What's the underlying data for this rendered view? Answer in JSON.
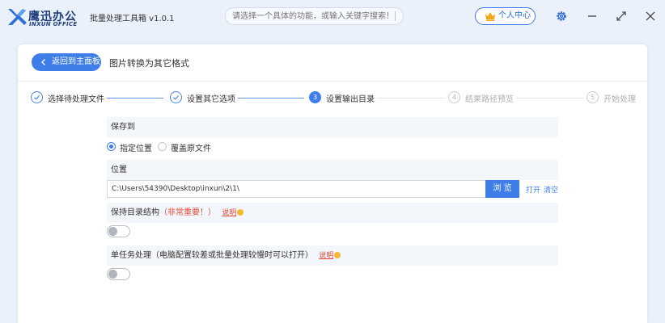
{
  "app": {
    "logo_text": "鹰迅办公",
    "logo_sub": "INXUN OFFICE",
    "title": "批量处理工具箱 v1.0.1"
  },
  "header": {
    "search_placeholder": "请选择一个具体的功能，或输入关键字搜索！",
    "user_center_label": "个人中心"
  },
  "nav": {
    "back_label": "返回到主面板",
    "page_title": "图片转换为其它格式"
  },
  "steps": [
    {
      "number": "1",
      "label": "选择待处理文件",
      "state": "done"
    },
    {
      "number": "2",
      "label": "设置其它选项",
      "state": "done"
    },
    {
      "number": "3",
      "label": "设置输出目录",
      "state": "active"
    },
    {
      "number": "4",
      "label": "结果路径预览",
      "state": "todo"
    },
    {
      "number": "5",
      "label": "开始处理",
      "state": "todo"
    }
  ],
  "save_to": {
    "title": "保存到",
    "options": [
      {
        "label": "指定位置",
        "selected": true
      },
      {
        "label": "覆盖原文件",
        "selected": false
      }
    ]
  },
  "location": {
    "title": "位置",
    "path": "C:\\Users\\54390\\Desktop\\inxun\\2\\1\\",
    "browse_label": "浏 览",
    "open_label": "打开",
    "clear_label": "清空"
  },
  "keep_structure": {
    "title": "保持目录结构",
    "warning": "（非常重要！）",
    "hint": "说明",
    "enabled": false
  },
  "single_task": {
    "title": "单任务处理（电脑配置较差或批量处理较慢时可以打开）",
    "hint": "说明",
    "enabled": false
  },
  "colors": {
    "accent": "#3f7ee8",
    "warning": "#e24b3c",
    "hint_dot": "#f5b731",
    "background": "#eaf1fb"
  }
}
